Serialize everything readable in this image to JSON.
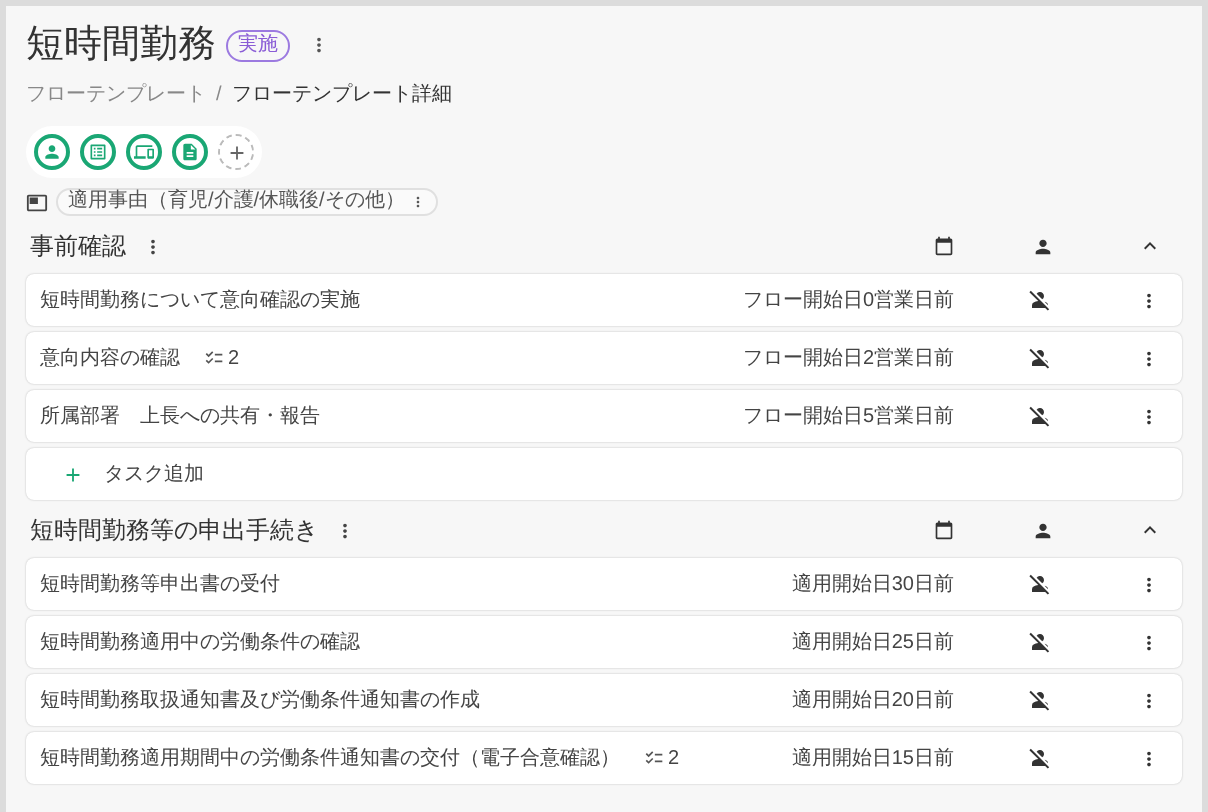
{
  "header": {
    "title": "短時間勤務",
    "badge": "実施",
    "breadcrumb": [
      {
        "label": "フローテンプレート",
        "current": false
      },
      {
        "label": "/",
        "current": false
      },
      {
        "label": "フローテンプレート詳細",
        "current": true
      }
    ],
    "chip": "適用事由（育児/介護/休職後/その他）"
  },
  "sections": [
    {
      "title": "事前確認",
      "expanded": true,
      "tasks": [
        {
          "title": "短時間勤務について意向確認の実施",
          "due": "フロー開始日0営業日前"
        },
        {
          "title": "意向内容の確認",
          "checklist": "2",
          "due": "フロー開始日2営業日前"
        },
        {
          "title": "所属部署　上長への共有・報告",
          "due": "フロー開始日5営業日前"
        }
      ],
      "add_task": "タスク追加"
    },
    {
      "title": "短時間勤務等の申出手続き",
      "expanded": true,
      "tasks": [
        {
          "title": "短時間勤務等申出書の受付",
          "due": "適用開始日30日前"
        },
        {
          "title": "短時間勤務適用中の労働条件の確認",
          "due": "適用開始日25日前"
        },
        {
          "title": "短時間勤務取扱通知書及び労働条件通知書の作成",
          "due": "適用開始日20日前"
        },
        {
          "title": "短時間勤務適用期間中の労働条件通知書の交付（電子合意確認）",
          "checklist": "2",
          "due": "適用開始日15日前"
        }
      ]
    }
  ]
}
